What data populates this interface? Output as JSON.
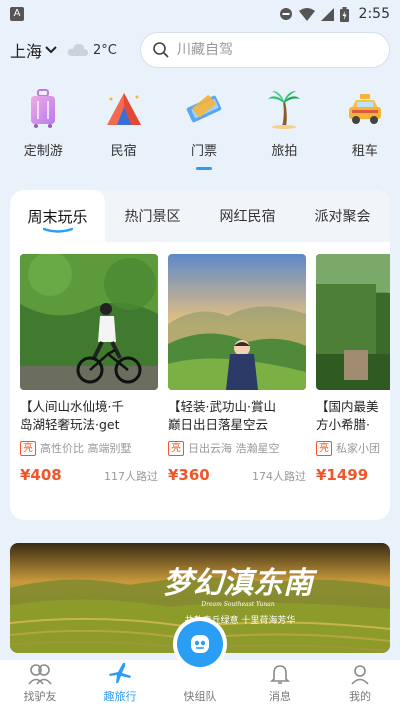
{
  "status_bar": {
    "app_badge": "A",
    "time": "2:55"
  },
  "header": {
    "city": "上海",
    "temperature": "2°C",
    "search_placeholder": "川藏自驾"
  },
  "categories": [
    {
      "label": "定制游",
      "icon": "suitcase-icon"
    },
    {
      "label": "民宿",
      "icon": "tent-icon"
    },
    {
      "label": "门票",
      "icon": "ticket-icon",
      "active": true
    },
    {
      "label": "旅拍",
      "icon": "palm-tree-icon"
    },
    {
      "label": "租车",
      "icon": "taxi-icon"
    }
  ],
  "tabs": [
    {
      "label": "周末玩乐",
      "active": true
    },
    {
      "label": "热门景区"
    },
    {
      "label": "网红民宿"
    },
    {
      "label": "派对聚会"
    }
  ],
  "cards": [
    {
      "title_line1": "【人间山水仙境·千",
      "title_line2": "岛湖轻奢玩法·get",
      "badge": "亮",
      "tags": "高性价比  高端别墅",
      "price": "¥408",
      "visitors": "117人路过"
    },
    {
      "title_line1": "【轻装·武功山·賞山",
      "title_line2": "巅日出日落星空云",
      "badge": "亮",
      "tags": "日出云海  浩瀚星空",
      "price": "¥360",
      "visitors": "174人路过"
    },
    {
      "title_line1": "【国内最美",
      "title_line2": "方小希腊·",
      "badge": "亮",
      "tags": "私家小团",
      "price": "¥1499",
      "visitors": ""
    }
  ],
  "banner": {
    "title": "梦幻滇东南",
    "subtitle": "Dream Southeast Yunan",
    "tagline": "共赴青丘绿意  十里荷海芳华"
  },
  "bottom_nav": [
    {
      "label": "找驴友",
      "icon": "companions-icon"
    },
    {
      "label": "趣旅行",
      "icon": "plane-icon",
      "active": true
    },
    {
      "label": "快组队",
      "icon": "team-icon"
    },
    {
      "label": "消息",
      "icon": "bell-icon"
    },
    {
      "label": "我的",
      "icon": "profile-icon"
    }
  ],
  "colors": {
    "accent": "#2a9df4",
    "price": "#f0562a",
    "background": "#e9f1fb"
  }
}
